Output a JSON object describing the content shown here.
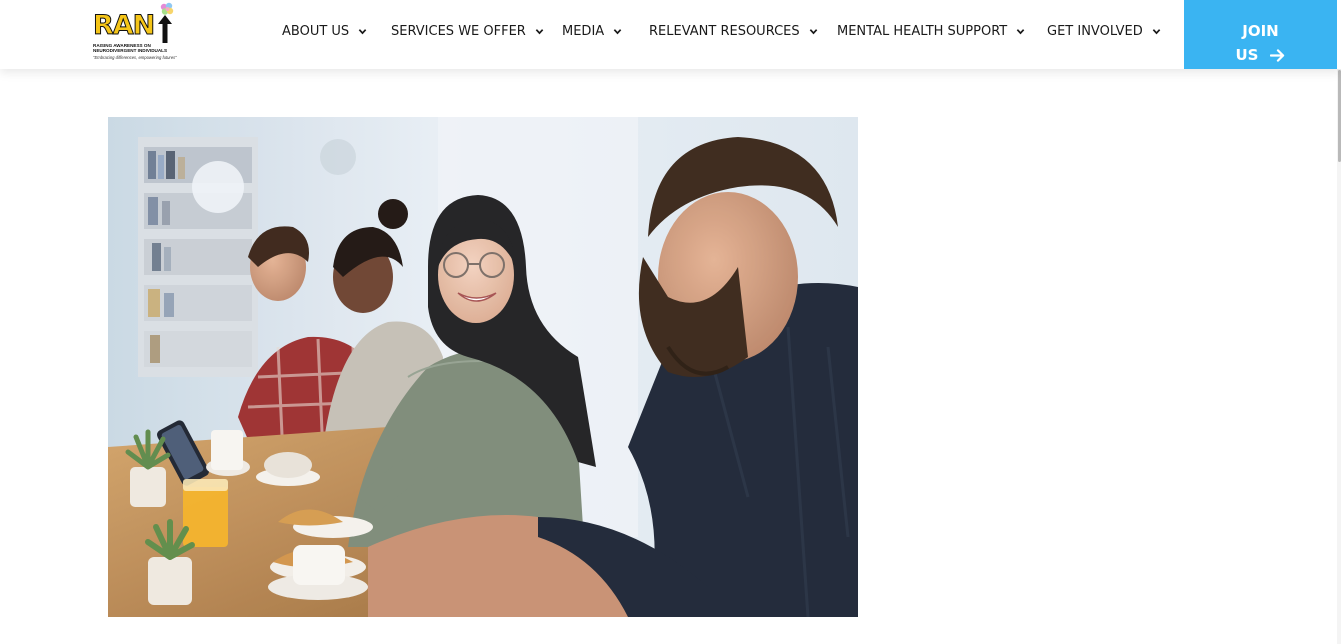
{
  "logo": {
    "main_text": "RAN",
    "subtitle_line1": "RAISING AWARENESS ON",
    "subtitle_line2": "NEURODIVERGENT INDIVIDUALS",
    "tagline": "\"Embracing differences, empowering futures\""
  },
  "nav": {
    "items": [
      {
        "label": "ABOUT US",
        "icon": "chevron-down-icon"
      },
      {
        "label": "SERVICES WE OFFER",
        "icon": "chevron-down-icon"
      },
      {
        "label": "MEDIA",
        "icon": "chevron-down-icon"
      },
      {
        "label": "RELEVANT RESOURCES",
        "icon": "chevron-down-icon"
      },
      {
        "label": "MENTAL HEALTH SUPPORT",
        "icon": "chevron-down-icon"
      },
      {
        "label": "GET INVOLVED",
        "icon": "chevron-down-icon"
      }
    ]
  },
  "join_button": {
    "line1": "JOIN",
    "line2": "US",
    "icon": "arrow-right-icon"
  },
  "colors": {
    "accent": "#3ab4f2",
    "logo_yellow": "#f5c518",
    "nav_text": "#1a1a1a",
    "background": "#ffffff"
  }
}
